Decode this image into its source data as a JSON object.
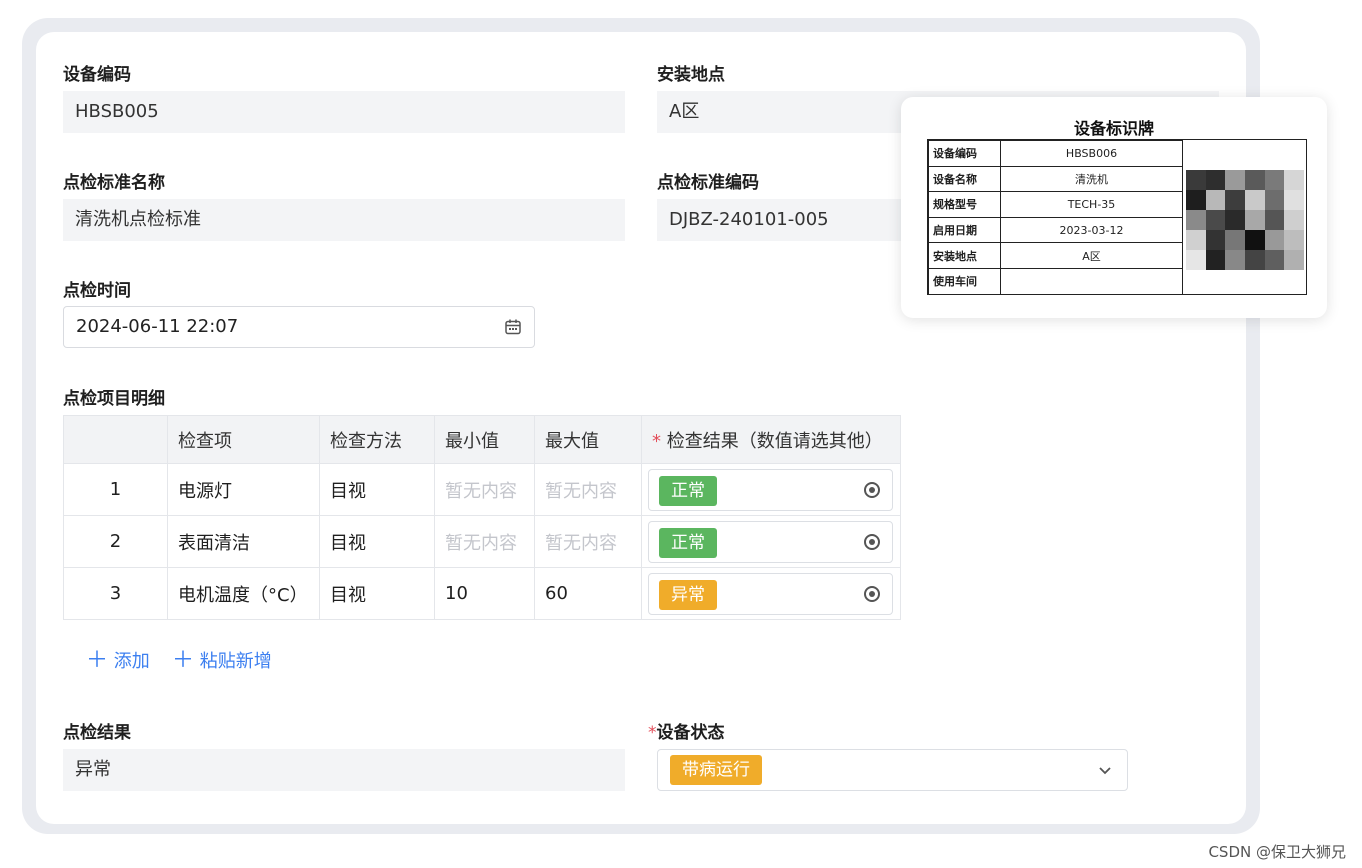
{
  "form": {
    "device_code": {
      "label": "设备编码",
      "value": "HBSB005"
    },
    "install_location": {
      "label": "安装地点",
      "value": "A区"
    },
    "standard_name": {
      "label": "点检标准名称",
      "value": "清洗机点检标准"
    },
    "standard_code": {
      "label": "点检标准编码",
      "value": "DJBZ-240101-005"
    },
    "inspect_time": {
      "label": "点检时间",
      "value": "2024-06-11 22:07"
    },
    "details_label": "点检项目明细",
    "result": {
      "label": "点检结果",
      "value": "异常"
    },
    "device_status": {
      "label": "设备状态",
      "required_mark": "*",
      "value": "带病运行",
      "color": "#f0ac2a"
    }
  },
  "table": {
    "headers": [
      "",
      "检查项",
      "检查方法",
      "最小值",
      "最大值",
      "检查结果（数值请选其他）"
    ],
    "required_mark": "*",
    "rows": [
      {
        "idx": "1",
        "item": "电源灯",
        "method": "目视",
        "min": "暂无内容",
        "max": "暂无内容",
        "result": "正常",
        "result_color": "#5bb65f"
      },
      {
        "idx": "2",
        "item": "表面清洁",
        "method": "目视",
        "min": "暂无内容",
        "max": "暂无内容",
        "result": "正常",
        "result_color": "#5bb65f"
      },
      {
        "idx": "3",
        "item": "电机温度（°C）",
        "method": "目视",
        "min": "10",
        "max": "60",
        "result": "异常",
        "result_color": "#f0ac2a"
      }
    ]
  },
  "actions": {
    "add": "添加",
    "paste_add": "粘贴新增",
    "icon": "plus-icon"
  },
  "nameplate": {
    "title": "设备标识牌",
    "rows": [
      {
        "k": "设备编码",
        "v": "HBSB006"
      },
      {
        "k": "设备名称",
        "v": "清洗机"
      },
      {
        "k": "规格型号",
        "v": "TECH-35"
      },
      {
        "k": "启用日期",
        "v": "2023-03-12"
      },
      {
        "k": "安装地点",
        "v": "A区"
      },
      {
        "k": "使用车间",
        "v": ""
      }
    ]
  },
  "watermark": "CSDN @保卫大狮兄",
  "colors": {
    "accent": "#3c7ff0",
    "normal": "#5bb65f",
    "abnormal": "#f0ac2a",
    "required": "#e34d59"
  }
}
